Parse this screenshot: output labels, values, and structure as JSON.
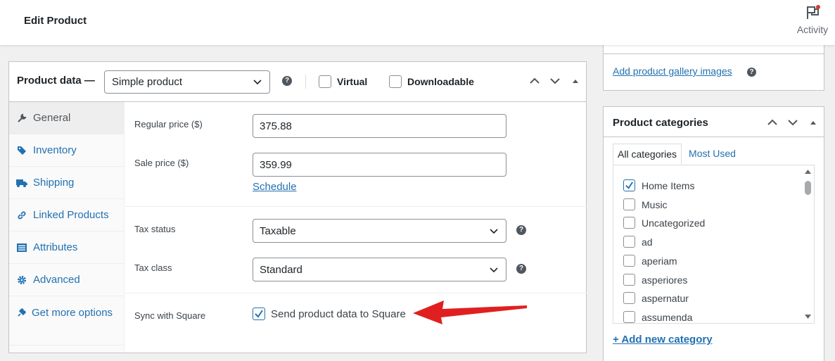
{
  "header": {
    "title": "Edit Product",
    "activity_label": "Activity"
  },
  "product_data": {
    "title": "Product data —",
    "type_select": "Simple product",
    "virtual_label": "Virtual",
    "downloadable_label": "Downloadable",
    "tabs": [
      {
        "label": "General",
        "icon": "wrench-icon"
      },
      {
        "label": "Inventory",
        "icon": "tag-icon"
      },
      {
        "label": "Shipping",
        "icon": "truck-icon"
      },
      {
        "label": "Linked Products",
        "icon": "link-icon"
      },
      {
        "label": "Attributes",
        "icon": "list-icon"
      },
      {
        "label": "Advanced",
        "icon": "gear-icon"
      },
      {
        "label": "Get more options",
        "icon": "plugin-icon"
      }
    ],
    "regular_price_label": "Regular price ($)",
    "regular_price_value": "375.88",
    "sale_price_label": "Sale price ($)",
    "sale_price_value": "359.99",
    "schedule_link": "Schedule",
    "tax_status_label": "Tax status",
    "tax_status_value": "Taxable",
    "tax_class_label": "Tax class",
    "tax_class_value": "Standard",
    "sync_label": "Sync with Square",
    "sync_checkbox_label": "Send product data to Square",
    "sync_checked": true
  },
  "gallery": {
    "add_link": "Add product gallery images"
  },
  "categories": {
    "title": "Product categories",
    "tabs": [
      "All categories",
      "Most Used"
    ],
    "items": [
      {
        "label": "Home Items",
        "checked": true
      },
      {
        "label": "Music",
        "checked": false
      },
      {
        "label": "Uncategorized",
        "checked": false
      },
      {
        "label": "ad",
        "checked": false
      },
      {
        "label": "aperiam",
        "checked": false
      },
      {
        "label": "asperiores",
        "checked": false
      },
      {
        "label": "aspernatur",
        "checked": false
      },
      {
        "label": "assumenda",
        "checked": false
      }
    ],
    "add_link": "+ Add new category"
  },
  "colors": {
    "accent": "#2271b1",
    "arrow": "#e02020",
    "notification": "#d63638"
  }
}
